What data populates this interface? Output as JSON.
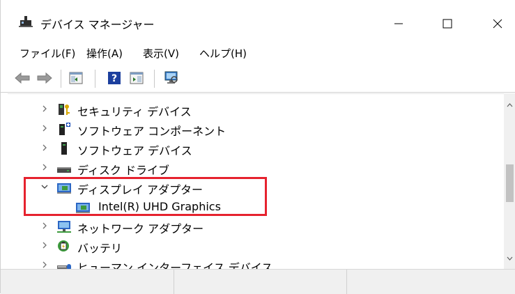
{
  "window": {
    "title": "デバイス マネージャー",
    "icon": "device-manager-icon",
    "controls": {
      "minimize": "minimize-icon",
      "maximize": "maximize-icon",
      "close": "close-icon"
    }
  },
  "menu": {
    "items": [
      "ファイル(F)",
      "操作(A)",
      "表示(V)",
      "ヘルプ(H)"
    ]
  },
  "toolbar": {
    "buttons": [
      "back-arrow-icon",
      "forward-arrow-icon",
      "show-hide-console-tree-icon",
      "help-icon",
      "properties-icon",
      "scan-hardware-icon"
    ]
  },
  "tree": {
    "items": [
      {
        "label": "セキュリティ デバイス",
        "icon": "security-device-icon",
        "expanded": false,
        "level": 0
      },
      {
        "label": "ソフトウェア コンポーネント",
        "icon": "software-component-icon",
        "expanded": false,
        "level": 0
      },
      {
        "label": "ソフトウェア デバイス",
        "icon": "software-device-icon",
        "expanded": false,
        "level": 0
      },
      {
        "label": "ディスク ドライブ",
        "icon": "disk-drive-icon",
        "expanded": false,
        "level": 0
      },
      {
        "label": "ディスプレイ アダプター",
        "icon": "display-adapter-icon",
        "expanded": true,
        "level": 0
      },
      {
        "label": "Intel(R) UHD Graphics",
        "icon": "display-adapter-icon",
        "expanded": null,
        "level": 1
      },
      {
        "label": "ネットワーク アダプター",
        "icon": "network-adapter-icon",
        "expanded": false,
        "level": 0
      },
      {
        "label": "バッテリ",
        "icon": "battery-icon",
        "expanded": false,
        "level": 0
      },
      {
        "label": "ヒューマン インターフェイス デバイス",
        "icon": "hid-icon",
        "expanded": false,
        "level": 0
      }
    ]
  },
  "colors": {
    "highlight": "#e6222e",
    "statusbar": "#f0f0f0"
  }
}
